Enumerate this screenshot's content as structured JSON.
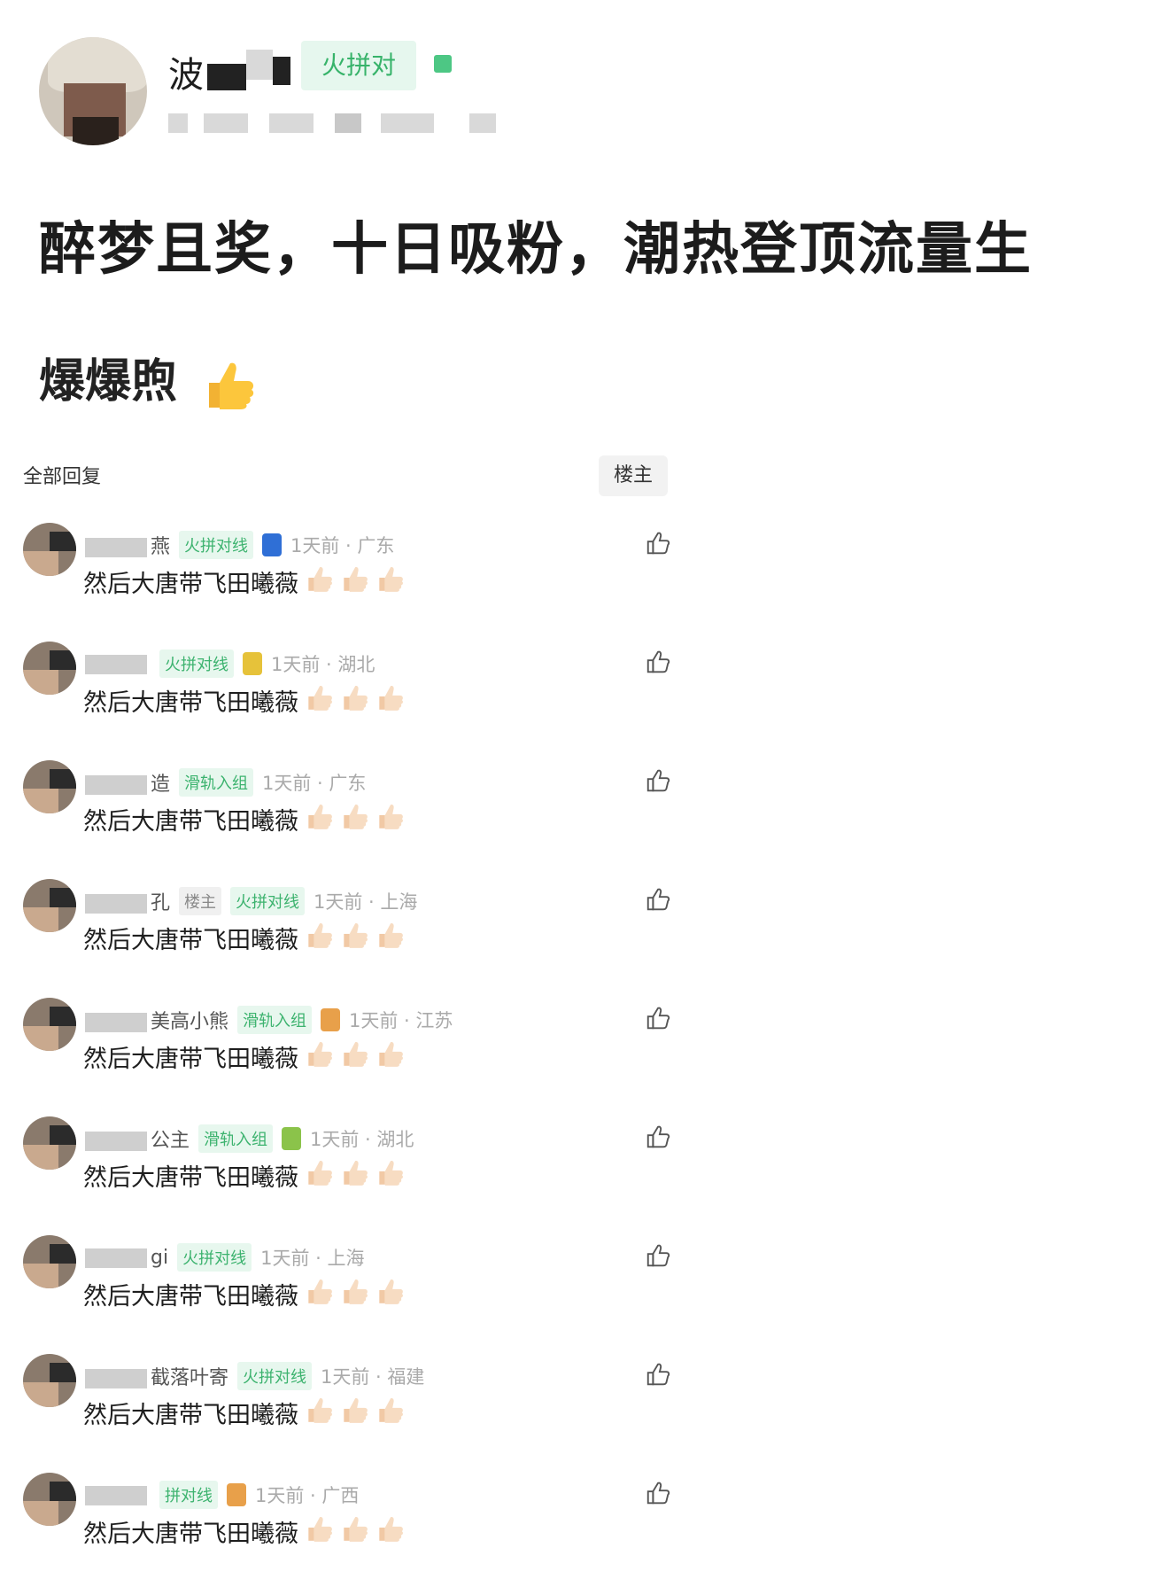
{
  "post": {
    "author_name": "波",
    "author_badge": "火拼对",
    "title": "醉梦且奖，十日吸粉，潮热登顶流量生",
    "body": "爆爆煦"
  },
  "replies_section": {
    "label": "全部回复",
    "filter_label": "楼主"
  },
  "replies": [
    {
      "name": "燕",
      "op_tag": "",
      "badge": "火拼对线",
      "medal": "can",
      "time": "1天前 · 广东",
      "text": "然后大唐带飞田曦薇"
    },
    {
      "name": "",
      "op_tag": "",
      "badge": "火拼对线",
      "medal": "flower",
      "time": "1天前 · 湖北",
      "text": "然后大唐带飞田曦薇"
    },
    {
      "name": "造",
      "op_tag": "",
      "badge": "滑轨入组",
      "medal": "",
      "time": "1天前 · 广东",
      "text": "然后大唐带飞田曦薇"
    },
    {
      "name": "孔",
      "op_tag": "楼主",
      "badge": "火拼对线",
      "medal": "",
      "time": "1天前 · 上海",
      "text": "然后大唐带飞田曦薇"
    },
    {
      "name": "美高小熊",
      "op_tag": "",
      "badge": "滑轨入组",
      "medal": "card",
      "time": "1天前 · 江苏",
      "text": "然后大唐带飞田曦薇"
    },
    {
      "name": "公主",
      "op_tag": "",
      "badge": "滑轨入组",
      "medal": "cake",
      "time": "1天前 · 湖北",
      "text": "然后大唐带飞田曦薇"
    },
    {
      "name": "gi",
      "op_tag": "",
      "badge": "火拼对线",
      "medal": "",
      "time": "1天前 · 上海",
      "text": "然后大唐带飞田曦薇"
    },
    {
      "name": "截落叶寄",
      "op_tag": "",
      "badge": "火拼对线",
      "medal": "",
      "time": "1天前 · 福建",
      "text": "然后大唐带飞田曦薇"
    },
    {
      "name": "",
      "op_tag": "",
      "badge": "拼对线",
      "medal": "card",
      "time": "1天前 · 广西",
      "text": "然后大唐带飞田曦薇"
    }
  ],
  "icons": {
    "like": "thumbs-up-outline-icon",
    "emoji": "thumbs-up-emoji"
  },
  "colors": {
    "accent_green": "#37b36a",
    "badge_bg": "#e6f7ee",
    "muted": "#aaaaaa"
  }
}
